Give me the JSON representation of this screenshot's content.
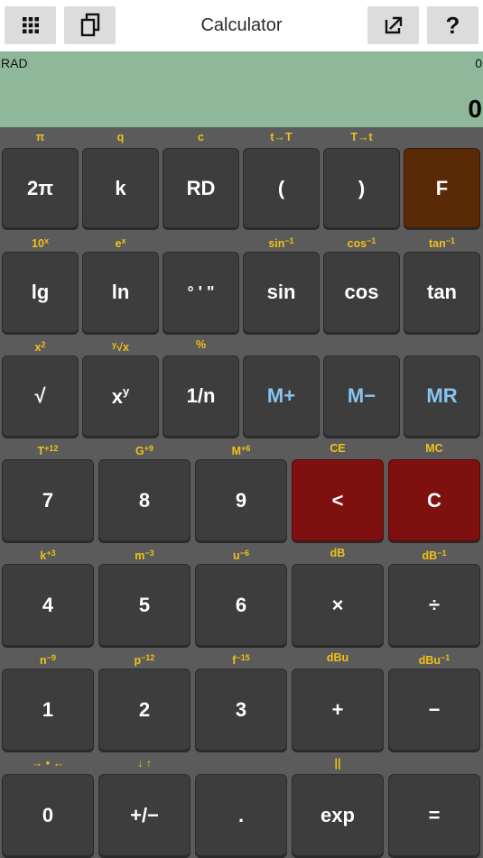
{
  "app": {
    "title": "Calculator"
  },
  "toolbar": {
    "keypad_icon": "keypad-grid-icon",
    "copy_icon": "copy-icon",
    "share_icon": "share-icon",
    "help_label": "?"
  },
  "display": {
    "mode": "RAD",
    "memory": "0",
    "value": "0"
  },
  "colors": {
    "display_bg": "#8fb79a",
    "secondary_label": "#f0c018",
    "memory_key_text": "#86c5f0",
    "f_key": "#5a2a06",
    "clear_keys": "#7e1010"
  },
  "keys": {
    "r1": [
      {
        "label": "2π",
        "sec": "π"
      },
      {
        "label": "k",
        "sec": "q"
      },
      {
        "label": "RD",
        "sec": "c"
      },
      {
        "label": "(",
        "sec": "t→T"
      },
      {
        "label": ")",
        "sec": "T→t"
      },
      {
        "label": "F",
        "sec": ""
      }
    ],
    "r2": [
      {
        "label": "lg",
        "sec": "10",
        "sec_sup": "x"
      },
      {
        "label": "ln",
        "sec": "e",
        "sec_sup": "x"
      },
      {
        "label": "° ' \"",
        "sec": ""
      },
      {
        "label": "sin",
        "sec": "sin",
        "sec_sup": "−1"
      },
      {
        "label": "cos",
        "sec": "cos",
        "sec_sup": "−1"
      },
      {
        "label": "tan",
        "sec": "tan",
        "sec_sup": "−1"
      }
    ],
    "r3": [
      {
        "label": "√",
        "sec": "x",
        "sec_sup": "2"
      },
      {
        "label": "x",
        "label_sup": "y",
        "sec_pre": "y",
        "sec": "√x"
      },
      {
        "label": "1/n",
        "sec": "%"
      },
      {
        "label": "M+",
        "sec": ""
      },
      {
        "label": "M−",
        "sec": ""
      },
      {
        "label": "MR",
        "sec": ""
      }
    ],
    "r4": [
      {
        "label": "7",
        "sec": "T",
        "sec_sup": "+12"
      },
      {
        "label": "8",
        "sec": "G",
        "sec_sup": "+9"
      },
      {
        "label": "9",
        "sec": "M",
        "sec_sup": "+6"
      },
      {
        "label": "<",
        "sec": "CE"
      },
      {
        "label": "C",
        "sec": "MC"
      }
    ],
    "r5": [
      {
        "label": "4",
        "sec": "k",
        "sec_sup": "+3"
      },
      {
        "label": "5",
        "sec": "m",
        "sec_sup": "−3"
      },
      {
        "label": "6",
        "sec": "u",
        "sec_sup": "−6"
      },
      {
        "label": "×",
        "sec": "dB"
      },
      {
        "label": "÷",
        "sec": "dB",
        "sec_sup": "−1"
      }
    ],
    "r6": [
      {
        "label": "1",
        "sec": "n",
        "sec_sup": "−9"
      },
      {
        "label": "2",
        "sec": "p",
        "sec_sup": "−12"
      },
      {
        "label": "3",
        "sec": "f",
        "sec_sup": "−15"
      },
      {
        "label": "+",
        "sec": "dBu"
      },
      {
        "label": "−",
        "sec": "dBu",
        "sec_sup": "−1"
      }
    ],
    "r7": [
      {
        "label": "0",
        "sec": "→ • ←"
      },
      {
        "label": "+/−",
        "sec": "↓ ↑"
      },
      {
        "label": ".",
        "sec": ""
      },
      {
        "label": "exp",
        "sec": "||"
      },
      {
        "label": "=",
        "sec": ""
      }
    ]
  }
}
